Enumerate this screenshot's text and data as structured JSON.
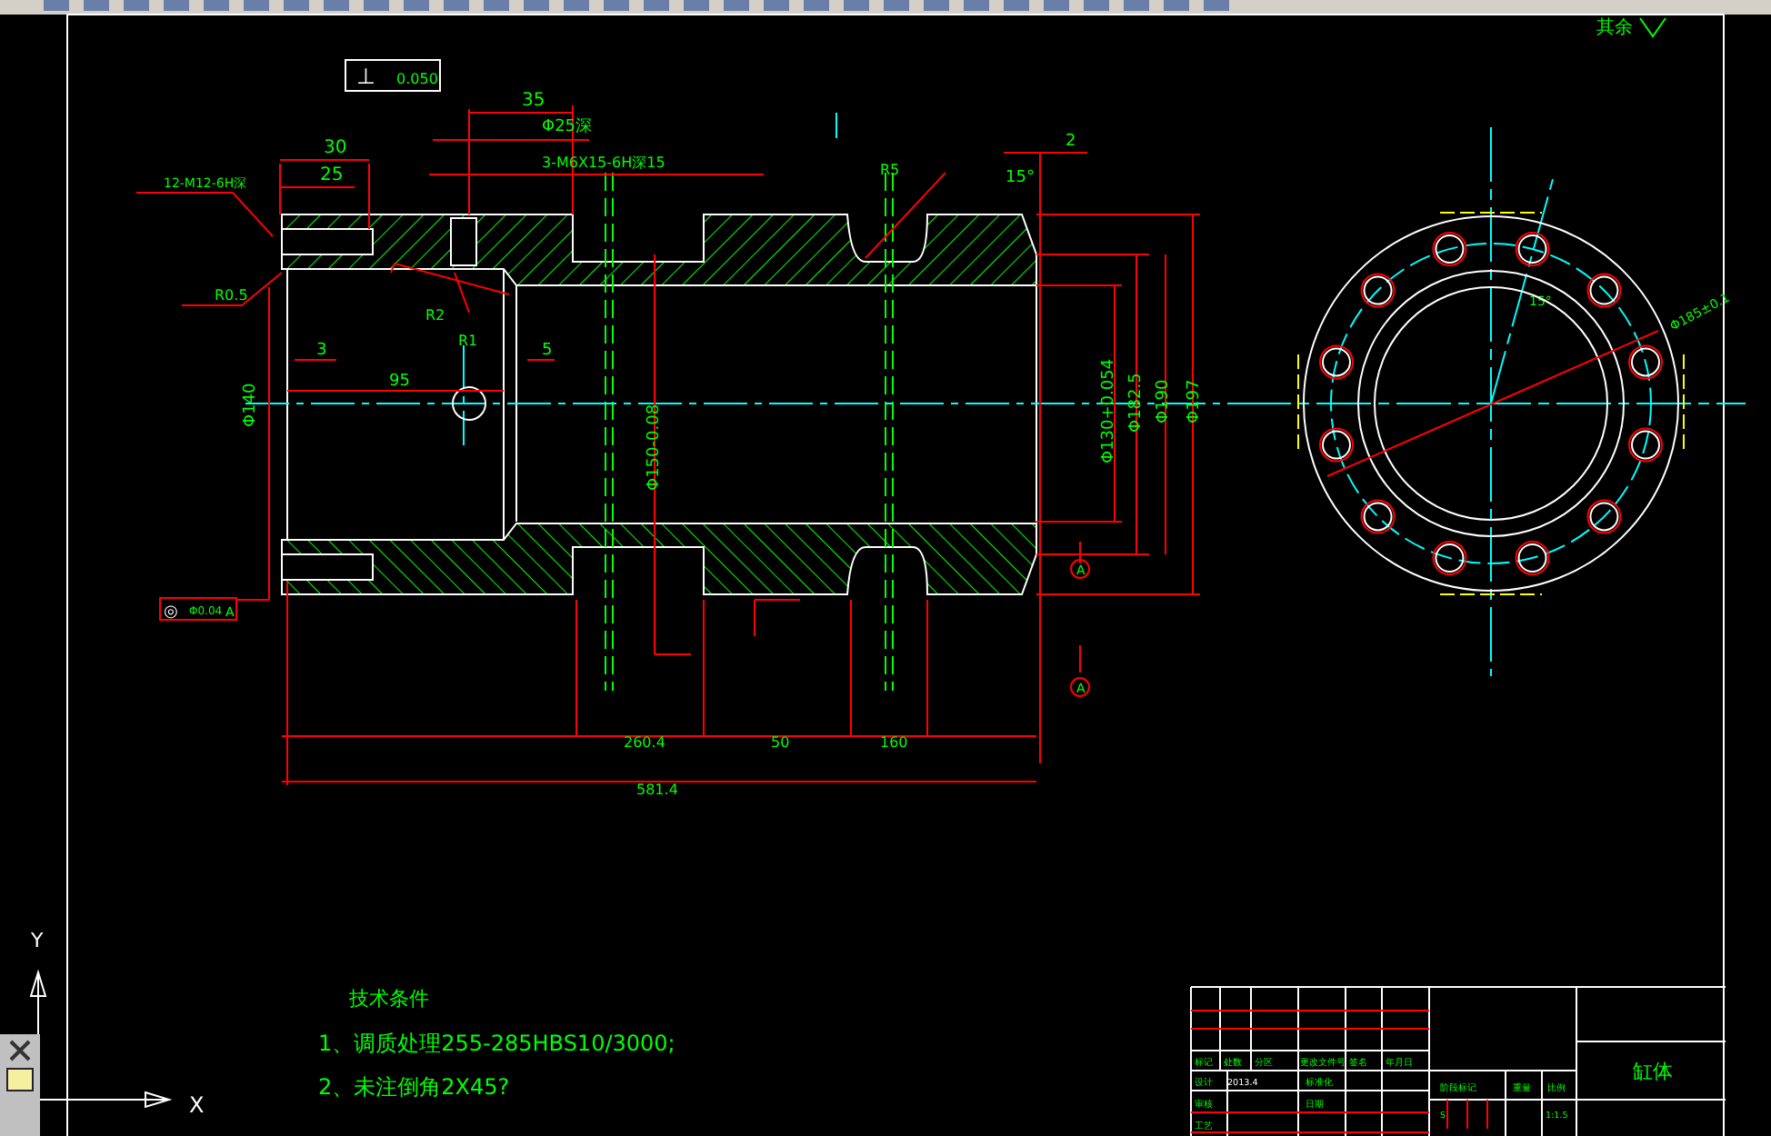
{
  "tolerance_frame": {
    "symbol": "⊥",
    "value": "0.050"
  },
  "annotations": [
    {
      "text": "35"
    },
    {
      "text": "Φ25深"
    },
    {
      "text": "30"
    },
    {
      "text": "3-M6X15-6H深15"
    },
    {
      "text": "25"
    },
    {
      "text": "12-M12-6H深"
    },
    {
      "text": "R0.5"
    },
    {
      "text": "R2"
    },
    {
      "text": "R1"
    },
    {
      "text": "3"
    },
    {
      "text": "95"
    },
    {
      "text": "5"
    },
    {
      "text": "R5"
    },
    {
      "text": "2"
    },
    {
      "text": "15°"
    },
    {
      "text": "260.4"
    },
    {
      "text": "50"
    },
    {
      "text": "160"
    },
    {
      "text": "581.4"
    },
    {
      "text": "Φ140"
    },
    {
      "text": "Φ150-0.08"
    },
    {
      "text": "Φ130+0.054"
    },
    {
      "text": "Φ182.5"
    },
    {
      "text": "Φ190"
    },
    {
      "text": "Φ197"
    },
    {
      "text": "Φ185±0.1"
    },
    {
      "text": "15°"
    },
    {
      "text": "其余"
    }
  ],
  "position_frame": {
    "symbol": "◎",
    "value": "Φ0.04",
    "datum": "A"
  },
  "datums": [
    {
      "text": "A"
    },
    {
      "text": "A"
    }
  ],
  "tech_requirements": {
    "title": "技术条件",
    "items": [
      "1、调质处理255-285HBS10/3000;",
      "2、未注倒角2X45?"
    ]
  },
  "title_block": {
    "cells": [
      "标记",
      "处数",
      "分区",
      "更改文件号",
      "签名",
      "年月日",
      "设计",
      "2013.4",
      "标准化",
      "审核",
      "日期",
      "工艺",
      "阶段标记",
      "重量",
      "比例",
      "S",
      "1:1.5"
    ],
    "part_name": "缸体"
  },
  "ucs": {
    "x": "X",
    "y": "Y"
  }
}
